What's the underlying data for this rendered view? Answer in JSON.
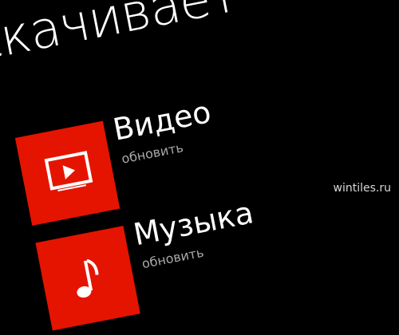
{
  "page": {
    "title": "скачивает"
  },
  "items": [
    {
      "title": "Видео",
      "subtitle": "обновить",
      "icon": "video-play-icon"
    },
    {
      "title": "Музыка",
      "subtitle": "обновить",
      "icon": "music-icon"
    }
  ],
  "watermark": "wintiles.ru",
  "colors": {
    "tile": "#e51400",
    "subtitle": "#a9a9a9",
    "text": "#ffffff",
    "background": "#000000"
  }
}
